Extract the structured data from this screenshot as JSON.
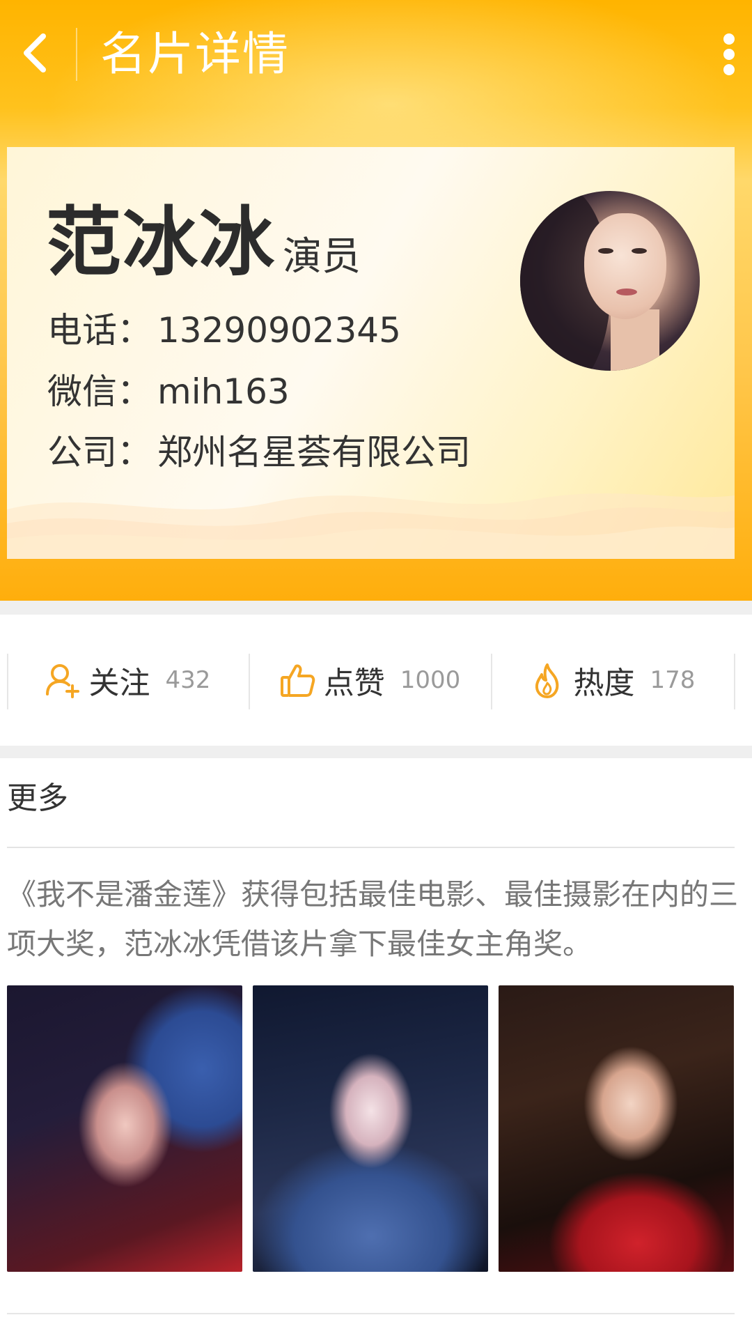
{
  "header": {
    "title": "名片详情",
    "back_icon": "chevron-left-icon",
    "menu_icon": "more-vertical-icon"
  },
  "card": {
    "name": "范冰冰",
    "role": "演员",
    "phone_label": "电话：",
    "phone": "13290902345",
    "wechat_label": "微信：",
    "wechat": "mih163",
    "company_label": "公司：",
    "company": "郑州名星荟有限公司"
  },
  "stats": [
    {
      "label": "关注",
      "value": "432",
      "icon": "follow-user-icon"
    },
    {
      "label": "点赞",
      "value": "1000",
      "icon": "thumbs-up-icon"
    },
    {
      "label": "热度",
      "value": "178",
      "icon": "flame-icon"
    }
  ],
  "more": {
    "title": "更多",
    "description": "《我不是潘金莲》获得包括最佳电影、最佳摄影在内的三项大奖，范冰冰凭借该片拿下最佳女主角奖。"
  },
  "colors": {
    "header_orange": "#ffb400",
    "accent_orange": "#f5a623"
  }
}
